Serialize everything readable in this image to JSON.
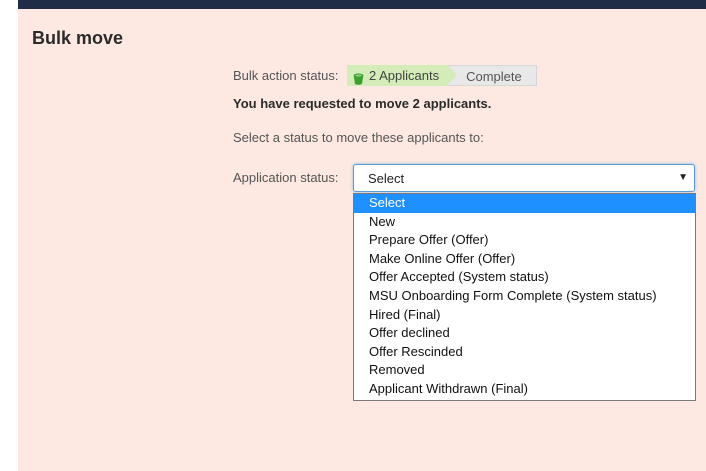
{
  "page": {
    "title": "Bulk move"
  },
  "bulk_action": {
    "status_label": "Bulk action status:",
    "steps": [
      {
        "label": "2 Applicants",
        "state": "active",
        "icon": "bucket-icon"
      },
      {
        "label": "Complete",
        "state": "pending"
      }
    ],
    "requested_text": "You have requested to move 2 applicants.",
    "instruction_text": "Select a status to move these applicants to:"
  },
  "application_status": {
    "label": "Application status:",
    "selected_value": "Select",
    "expanded": true,
    "options": [
      "Select",
      "New",
      "Prepare Offer (Offer)",
      "Make Online Offer (Offer)",
      "Offer Accepted (System status)",
      "MSU Onboarding Form Complete (System status)",
      "Hired (Final)",
      "Offer declined",
      "Offer Rescinded",
      "Removed",
      "Applicant Withdrawn (Final)"
    ],
    "highlighted_index": 0
  },
  "colors": {
    "header_bar": "#1f2d47",
    "panel_background": "#fde9e1",
    "active_step": "#d3ecb8",
    "pending_step": "#e8e8e8",
    "highlight": "#1e90ff",
    "focus_border": "#5b9ad6"
  }
}
